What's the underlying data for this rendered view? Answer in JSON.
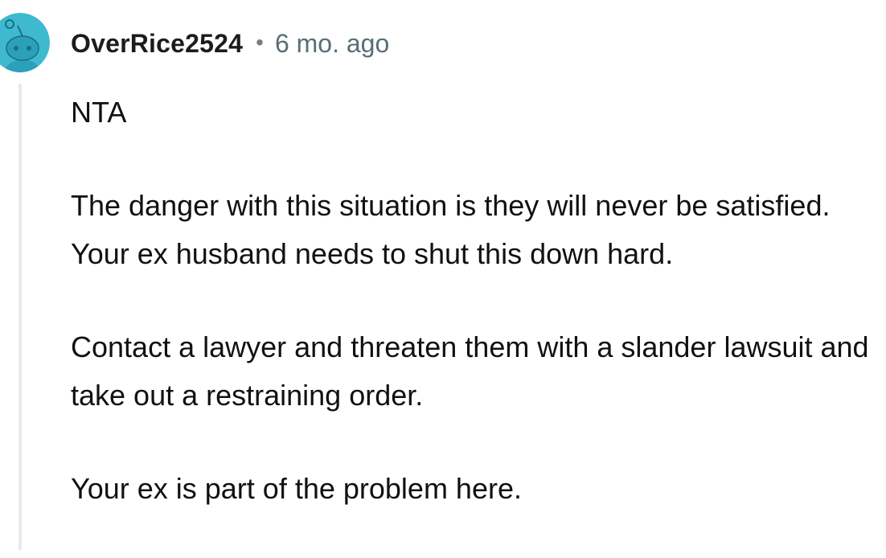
{
  "comment": {
    "author": "OverRice2524",
    "separator": "•",
    "timestamp": "6 mo. ago",
    "paragraphs": [
      "NTA",
      "The danger with this situation is they will never be satisfied. Your ex husband needs to shut this down hard.",
      "Contact a lawyer and threaten them with a slander lawsuit and take out a restraining order.",
      "Your ex is part of the problem here."
    ]
  },
  "colors": {
    "avatar_bg": "#3fb9cf",
    "thread_line": "#e5ebee",
    "timestamp": "#576f76"
  },
  "icons": {
    "avatar": "reddit-snoo-avatar-icon"
  }
}
